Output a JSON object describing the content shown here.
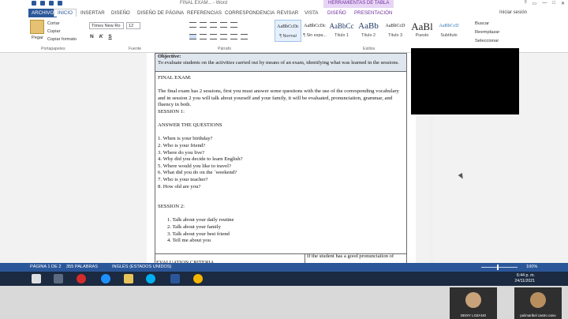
{
  "window": {
    "title": "FINAL EXAM... - Word",
    "contextual_tab": "HERRAMIENTAS DE TABLA",
    "controls": [
      "?",
      "▭",
      "—",
      "□",
      "✕"
    ]
  },
  "tabs": {
    "file": "ARCHIVO",
    "items": [
      "INICIO",
      "INSERTAR",
      "DISEÑO",
      "DISEÑO DE PÁGINA",
      "REFERENCIAS",
      "CORRESPONDENCIA",
      "REVISAR",
      "VISTA"
    ],
    "contextual": [
      "DISEÑO",
      "PRESENTACIÓN"
    ],
    "signin": "Iniciar sesión"
  },
  "ribbon": {
    "clipboard": {
      "paste": "Pegar",
      "cut": "Cortar",
      "copy": "Copiar",
      "format_painter": "Copiar formato",
      "group": "Portapapeles"
    },
    "font": {
      "name": "Times New Ro",
      "size": "12",
      "bold": "N",
      "italic": "K",
      "underline": "S",
      "group": "Fuente"
    },
    "paragraph": {
      "group": "Párrafo"
    },
    "styles": {
      "items": [
        {
          "sample": "AaBbCcDc",
          "name": "¶ Normal"
        },
        {
          "sample": "AaBbCcDc",
          "name": "¶ Sin espa..."
        },
        {
          "sample": "AaBbCc",
          "name": "Título 1"
        },
        {
          "sample": "AaBb",
          "name": "Título 2"
        },
        {
          "sample": "AaBbCcD",
          "name": "Título 3"
        },
        {
          "sample": "AaBl",
          "name": "Puesto"
        },
        {
          "sample": "AaBbCcD",
          "name": "Subtítulo"
        }
      ],
      "group": "Estilos"
    },
    "editing": {
      "find": "Buscar",
      "replace": "Reemplazar",
      "select": "Seleccionar"
    }
  },
  "document": {
    "objective_title": "Objective:",
    "objective_text": "To evaluate students on the activities carried out by means of an exam, identifying what was learned in the sessions.",
    "heading": "FINAL EXAM:",
    "intro": "The final exam has 2 sessions, first you must answer some questions with the use of the corresponding vocabulary and in session 2 you will talk about yourself and your family, it will be evaluated, pronunciation, grammar, and fluency in both.",
    "session1": "SESSION 1:",
    "answer": "ANSWER THE QUESTIONS",
    "questions": [
      "1. When is your birthday?",
      "2. Who is your friend?",
      "3. Where do you live?",
      "4. Why did you decide to learn English?",
      "5. Where would you like to travel?",
      "6. What did you do on the `weekend?",
      "7.  Who is your teacher?",
      "8.   How old are you?"
    ],
    "session2": "SESSION 2:",
    "tasks": [
      "1.   Talk about your daily routine",
      "2.   Talk about your family",
      "3.   Talk about your best friend",
      "4.   Tell me about you"
    ],
    "bottom_left": "EVALUATION CRITERIA",
    "bottom_right": "If the student has a good pronunciation of"
  },
  "status": {
    "page": "PÁGINA 1 DE 2",
    "words": "355 PALABRAS",
    "language": "INGLÉS (ESTADOS UNIDOS)",
    "zoom": "100%"
  },
  "taskbar": {
    "time": "6:44 p. m.",
    "date": "24/11/2021"
  },
  "participants": [
    {
      "name": "DEISY LOZANO"
    },
    {
      "name": "pulimaribel castro cano"
    }
  ]
}
